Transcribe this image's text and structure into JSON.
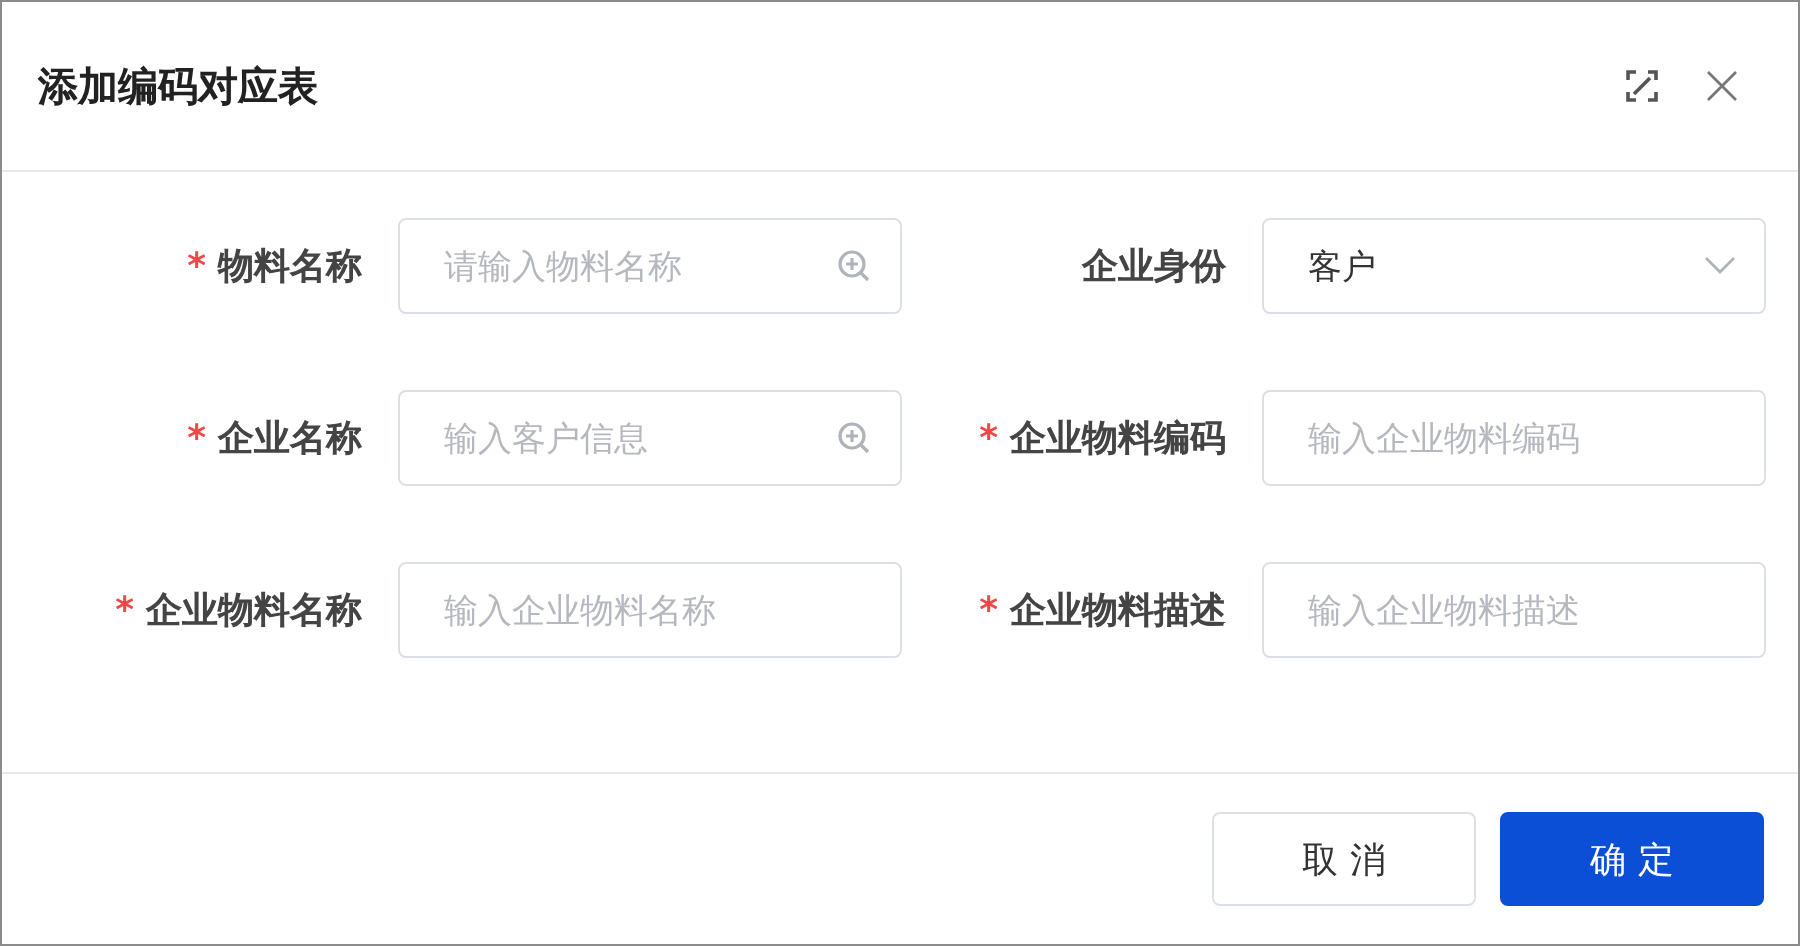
{
  "dialog": {
    "title": "添加编码对应表"
  },
  "fields": [
    {
      "label": "物料名称",
      "required": true,
      "kind": "search",
      "placeholder": "请输入物料名称"
    },
    {
      "label": "企业身份",
      "required": false,
      "kind": "select",
      "value": "客户"
    },
    {
      "label": "企业名称",
      "required": true,
      "kind": "search",
      "placeholder": "输入客户信息"
    },
    {
      "label": "企业物料编码",
      "required": true,
      "kind": "text",
      "placeholder": "输入企业物料编码"
    },
    {
      "label": "企业物料名称",
      "required": true,
      "kind": "text",
      "placeholder": "输入企业物料名称"
    },
    {
      "label": "企业物料描述",
      "required": true,
      "kind": "text",
      "placeholder": "输入企业物料描述"
    }
  ],
  "required_mark": "*",
  "buttons": [
    {
      "label": "取 消",
      "kind": "secondary"
    },
    {
      "label": "确 定",
      "kind": "primary"
    }
  ]
}
